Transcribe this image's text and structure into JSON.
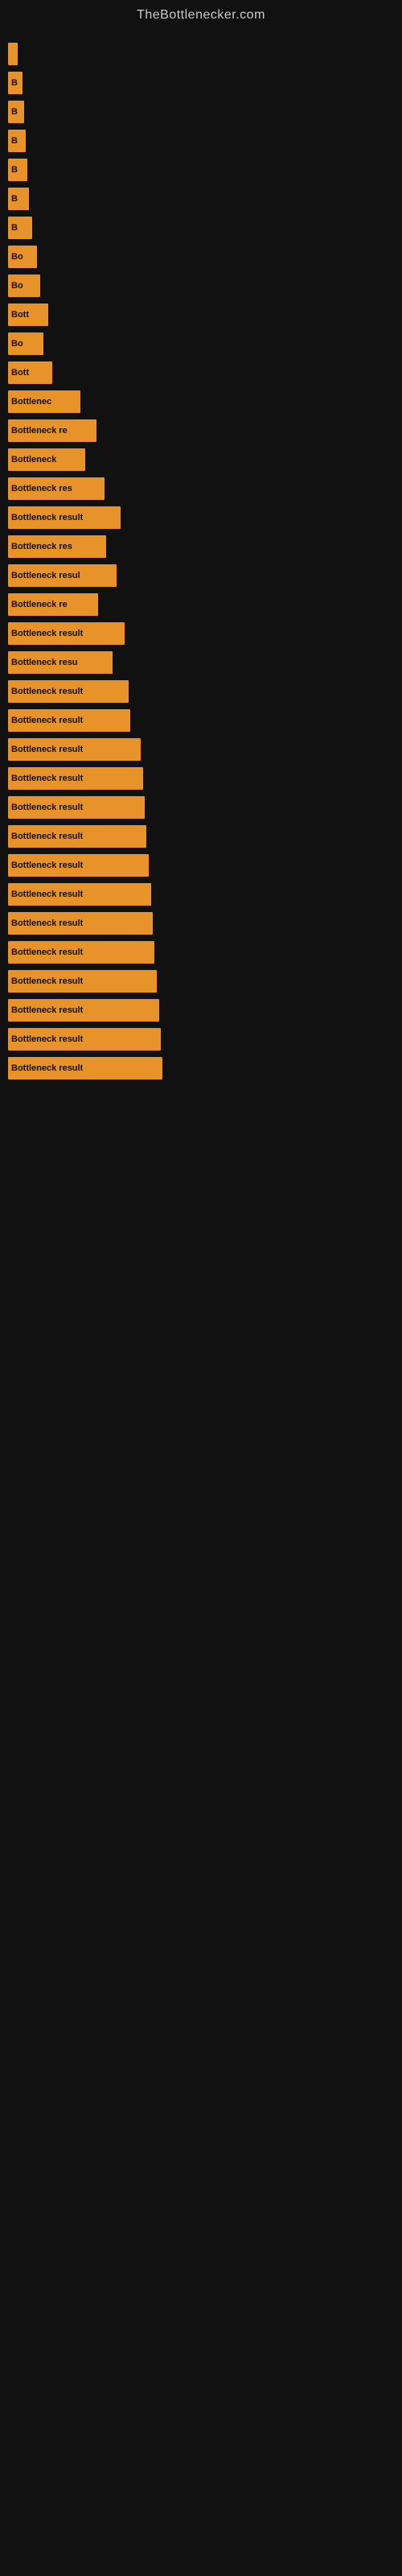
{
  "site": {
    "title": "TheBottlenecker.com"
  },
  "bars": [
    {
      "id": 1,
      "label": "",
      "width": 12
    },
    {
      "id": 2,
      "label": "B",
      "width": 18
    },
    {
      "id": 3,
      "label": "B",
      "width": 20
    },
    {
      "id": 4,
      "label": "B",
      "width": 22
    },
    {
      "id": 5,
      "label": "B",
      "width": 24
    },
    {
      "id": 6,
      "label": "B",
      "width": 26
    },
    {
      "id": 7,
      "label": "B",
      "width": 30
    },
    {
      "id": 8,
      "label": "Bo",
      "width": 36
    },
    {
      "id": 9,
      "label": "Bo",
      "width": 40
    },
    {
      "id": 10,
      "label": "Bott",
      "width": 50
    },
    {
      "id": 11,
      "label": "Bo",
      "width": 44
    },
    {
      "id": 12,
      "label": "Bott",
      "width": 55
    },
    {
      "id": 13,
      "label": "Bottlenec",
      "width": 90
    },
    {
      "id": 14,
      "label": "Bottleneck re",
      "width": 110
    },
    {
      "id": 15,
      "label": "Bottleneck",
      "width": 96
    },
    {
      "id": 16,
      "label": "Bottleneck res",
      "width": 120
    },
    {
      "id": 17,
      "label": "Bottleneck result",
      "width": 140
    },
    {
      "id": 18,
      "label": "Bottleneck res",
      "width": 122
    },
    {
      "id": 19,
      "label": "Bottleneck resul",
      "width": 135
    },
    {
      "id": 20,
      "label": "Bottleneck re",
      "width": 112
    },
    {
      "id": 21,
      "label": "Bottleneck result",
      "width": 145
    },
    {
      "id": 22,
      "label": "Bottleneck resu",
      "width": 130
    },
    {
      "id": 23,
      "label": "Bottleneck result",
      "width": 150
    },
    {
      "id": 24,
      "label": "Bottleneck result",
      "width": 152
    },
    {
      "id": 25,
      "label": "Bottleneck result",
      "width": 165
    },
    {
      "id": 26,
      "label": "Bottleneck result",
      "width": 168
    },
    {
      "id": 27,
      "label": "Bottleneck result",
      "width": 170
    },
    {
      "id": 28,
      "label": "Bottleneck result",
      "width": 172
    },
    {
      "id": 29,
      "label": "Bottleneck result",
      "width": 175
    },
    {
      "id": 30,
      "label": "Bottleneck result",
      "width": 178
    },
    {
      "id": 31,
      "label": "Bottleneck result",
      "width": 180
    },
    {
      "id": 32,
      "label": "Bottleneck result",
      "width": 182
    },
    {
      "id": 33,
      "label": "Bottleneck result",
      "width": 185
    },
    {
      "id": 34,
      "label": "Bottleneck result",
      "width": 188
    },
    {
      "id": 35,
      "label": "Bottleneck result",
      "width": 190
    },
    {
      "id": 36,
      "label": "Bottleneck result",
      "width": 192
    }
  ]
}
